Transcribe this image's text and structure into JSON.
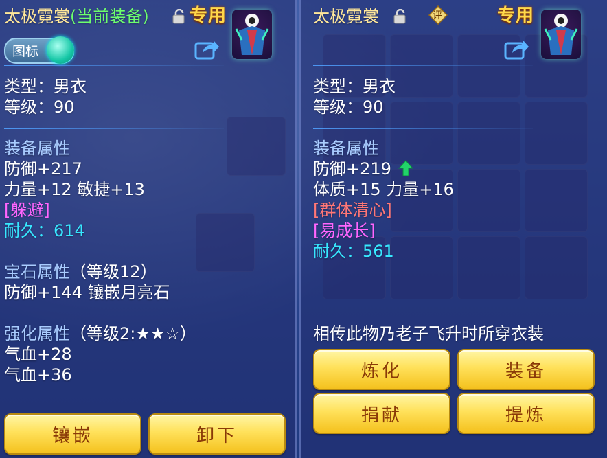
{
  "colors": {
    "title": "#ffe79a",
    "current_equip": "#6dff6d",
    "label": "#a9ccff",
    "special_pink": "#ff66ff",
    "special_red": "#ff7777",
    "durability": "#37e7ff",
    "button_text": "#8a3a08"
  },
  "left": {
    "title": "太极霓裳",
    "title_suffix": "(当前装备)",
    "exclusive": "专用",
    "toggle_label": "图标",
    "type_line": "类型：男衣",
    "level_line": "等级：90",
    "attr_heading": "装备属性",
    "defense": "防御+217",
    "stats": "力量+12 敏捷+13",
    "special": "[躲避]",
    "durability_label": "耐久：",
    "durability_value": "614",
    "gem_heading": "宝石属性",
    "gem_level": "（等级12）",
    "gem_effect": "防御+144 镶嵌月亮石",
    "enhance_heading": "强化属性",
    "enhance_level": "（等级2:★★☆）",
    "hp1": "气血+28",
    "hp2": "气血+36",
    "buttons": [
      "镶嵌",
      "卸下"
    ]
  },
  "right": {
    "title": "太极霓裳",
    "rate_badge": "评",
    "exclusive": "专用",
    "type_line": "类型：男衣",
    "level_line": "等级：90",
    "attr_heading": "装备属性",
    "defense": "防御+219",
    "stats": "体质+15 力量+16",
    "special1": "[群体清心]",
    "special2": "[易成长]",
    "durability_label": "耐久：",
    "durability_value": "561",
    "description": "相传此物乃老子飞升时所穿衣装",
    "buttons": [
      "炼化",
      "装备",
      "捐献",
      "提炼"
    ]
  }
}
